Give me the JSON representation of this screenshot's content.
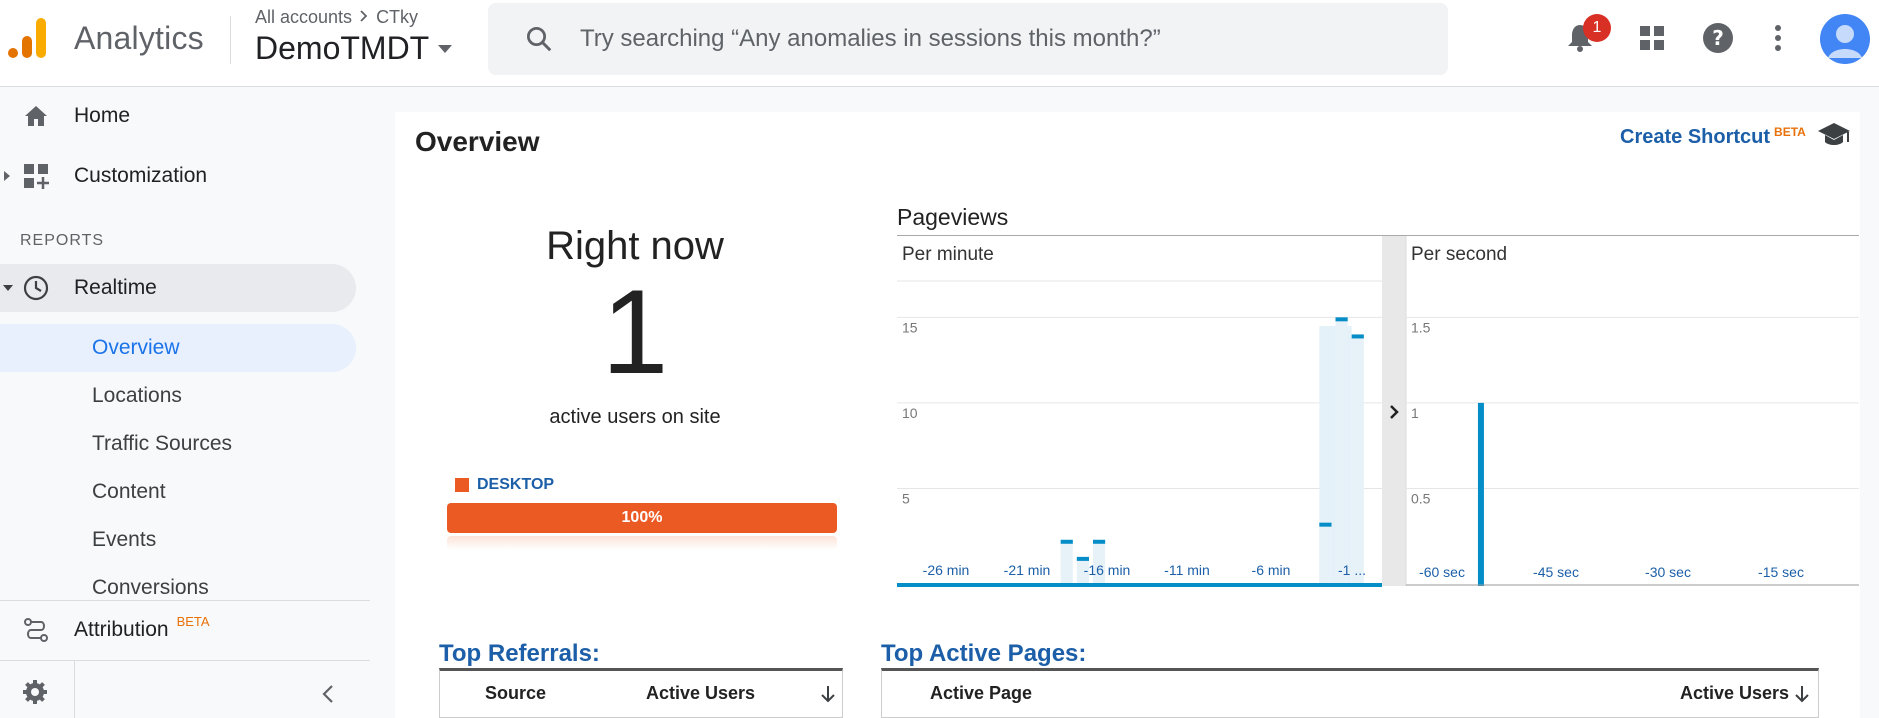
{
  "header": {
    "app_title": "Analytics",
    "crumb_account": "All accounts",
    "crumb_property": "CTky",
    "property_name": "DemoTMDT",
    "search_placeholder": "Try searching “Any anomalies in sessions this month?”",
    "notification_count": "1",
    "brand_colors": {
      "logo_dark": "#e37400",
      "logo_light": "#f9ab00"
    }
  },
  "sidebar": {
    "items": [
      {
        "label": "Home",
        "icon": "home-icon"
      },
      {
        "label": "Customization",
        "icon": "customization-icon"
      }
    ],
    "section_title": "REPORTS",
    "realtime_label": "Realtime",
    "realtime_sub": [
      "Overview",
      "Locations",
      "Traffic Sources",
      "Content",
      "Events",
      "Conversions"
    ],
    "attribution_label": "Attribution",
    "attribution_badge": "BETA"
  },
  "main": {
    "title": "Overview",
    "shortcut_label": "Create Shortcut",
    "shortcut_badge": "BETA",
    "right_now_title": "Right now",
    "active_count": "1",
    "active_sub": "active users on site",
    "device_label": "DESKTOP",
    "device_percent": "100%",
    "device_fraction": 1.0,
    "pageviews_title": "Pageviews",
    "top_referrals_title": "Top Referrals:",
    "top_pages_title": "Top Active Pages:",
    "referrals_cols": [
      "Source",
      "Active Users"
    ],
    "pages_cols": [
      "Active Page",
      "Active Users"
    ]
  },
  "chart_data": [
    {
      "type": "bar",
      "title": "Per minute",
      "ylim": [
        0,
        18
      ],
      "yticks": [
        "5",
        "10",
        "15"
      ],
      "x_tick_labels": [
        "-26 min",
        "-21 min",
        "-16 min",
        "-11 min",
        "-6 min",
        "-1 ..."
      ],
      "series": [
        {
          "x": [
            -30,
            -29,
            -28,
            -27,
            -26,
            -25,
            -24,
            -23,
            -22,
            -21,
            -20,
            -19,
            -18,
            -17,
            -16,
            -15,
            -14,
            -13,
            -12,
            -11,
            -10,
            -9,
            -8,
            -7,
            -6,
            -5,
            -4,
            -3,
            -2,
            -1
          ],
          "values": [
            0,
            0,
            0,
            0,
            0,
            0,
            0,
            0,
            0,
            0,
            2,
            1,
            2,
            0,
            0,
            0,
            0,
            0,
            0,
            0,
            0,
            0,
            0,
            0,
            0,
            0,
            3,
            15,
            14,
            0
          ]
        }
      ],
      "highlight": "last 3 minutes shaded"
    },
    {
      "type": "bar",
      "title": "Per second",
      "ylim": [
        0,
        1.8
      ],
      "yticks": [
        "0.5",
        "1",
        "1.5"
      ],
      "x_tick_labels": [
        "-60 sec",
        "-45 sec",
        "-30 sec",
        "-15 sec"
      ],
      "series": [
        {
          "x": [
            -51
          ],
          "values": [
            1
          ]
        }
      ]
    }
  ]
}
